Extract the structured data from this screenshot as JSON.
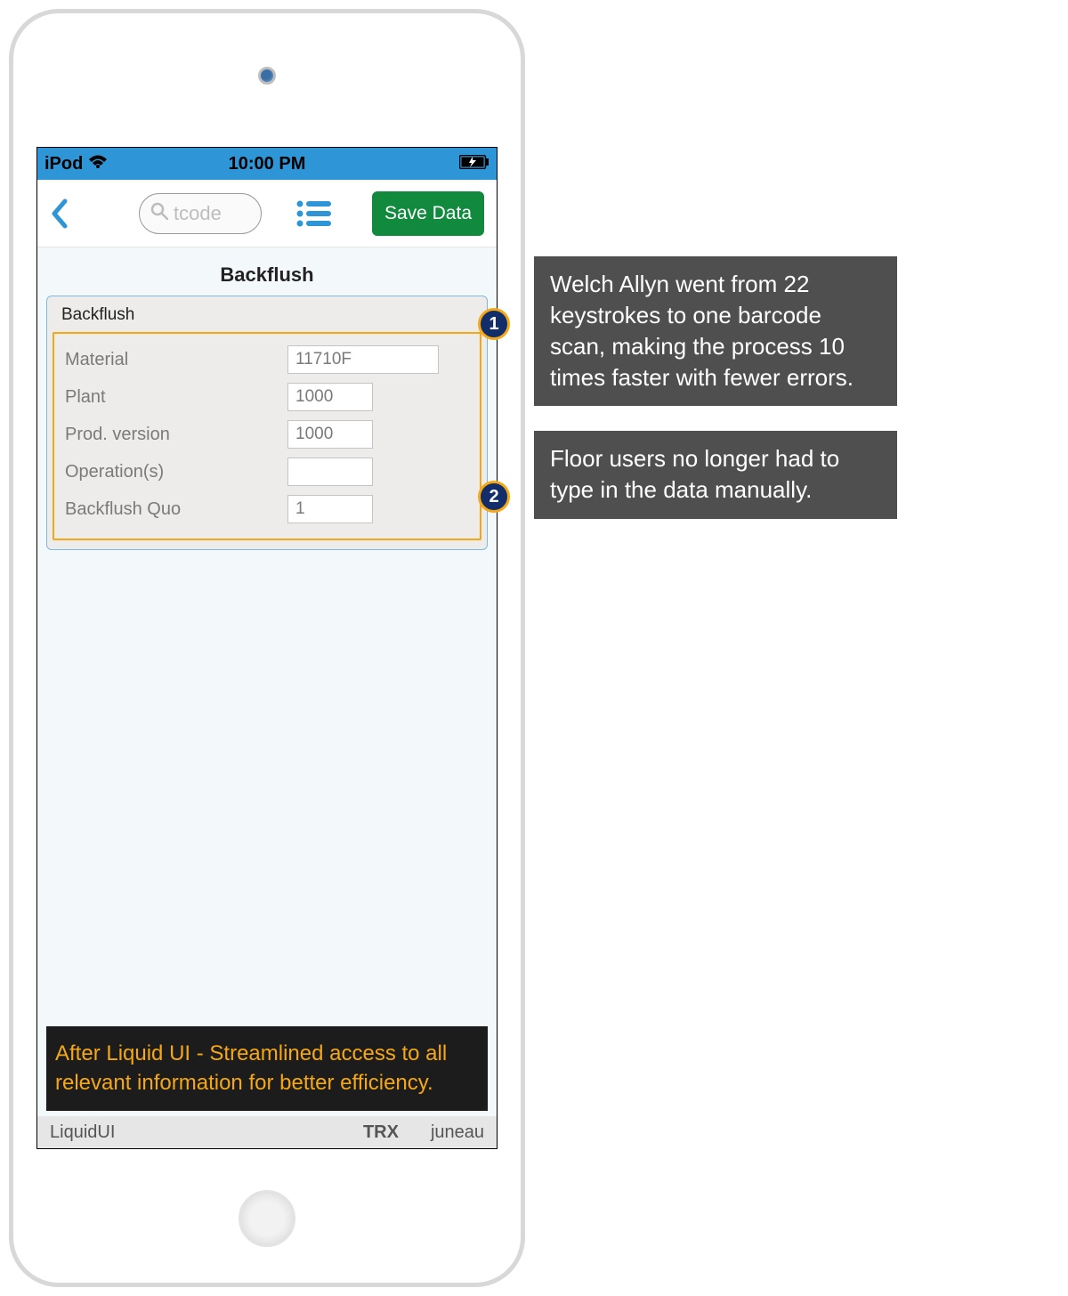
{
  "status": {
    "carrier": "iPod",
    "time": "10:00  PM"
  },
  "toolbar": {
    "search_placeholder": "tcode",
    "save_label": "Save Data"
  },
  "page": {
    "title": "Backflush",
    "panel_legend": "Backflush"
  },
  "fields": {
    "material_label": "Material",
    "material_value": "11710F",
    "plant_label": "Plant",
    "plant_value": "1000",
    "prodver_label": "Prod. version",
    "prodver_value": "1000",
    "ops_label": "Operation(s)",
    "ops_value": "",
    "bfq_label": "Backflush Quo",
    "bfq_value": "1"
  },
  "caption": "After Liquid UI - Streamlined access to all relevant information for better efficiency.",
  "footer": {
    "left": "LiquidUI",
    "center": "TRX",
    "right": "juneau"
  },
  "annotations": {
    "b1": "1",
    "b2": "2",
    "note1": "Welch Allyn went from 22 keystrokes to one barcode scan, making the process 10 times faster with fewer errors.",
    "note2": "Floor users no longer had to type in the data manually."
  }
}
